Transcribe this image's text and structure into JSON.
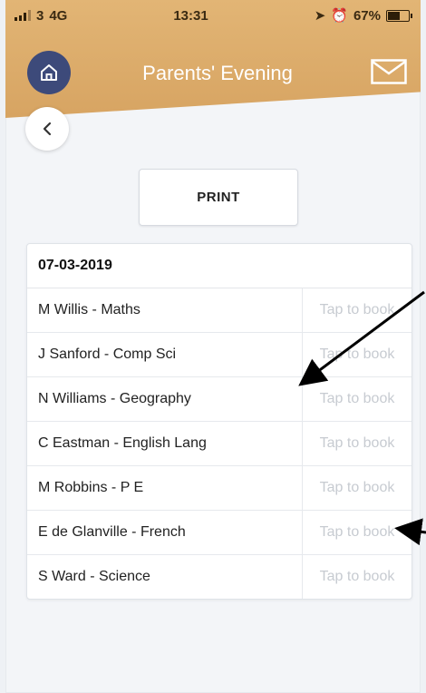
{
  "status": {
    "carrier": "3",
    "network": "4G",
    "time": "13:31",
    "battery": "67%",
    "battery_level": 0.67
  },
  "header": {
    "title": "Parents' Evening"
  },
  "actions": {
    "print_label": "PRINT"
  },
  "appointments": {
    "date": "07-03-2019",
    "rows": [
      {
        "teacher": "M Willis - Maths",
        "action": "Tap to book"
      },
      {
        "teacher": "J Sanford - Comp Sci",
        "action": "Tap to book"
      },
      {
        "teacher": "N Williams - Geography",
        "action": "Tap to book"
      },
      {
        "teacher": "C Eastman - English Lang",
        "action": "Tap to book"
      },
      {
        "teacher": "M Robbins - P E",
        "action": "Tap to book"
      },
      {
        "teacher": "E de Glanville - French",
        "action": "Tap to book"
      },
      {
        "teacher": "S Ward - Science",
        "action": "Tap to book"
      }
    ]
  },
  "icons": {
    "home": "home-icon",
    "mail": "mail-icon",
    "back": "chevron-left-icon"
  },
  "colors": {
    "header": "#d9a865",
    "home_button": "#3d4a7a",
    "muted_text": "#c7cbd1"
  }
}
